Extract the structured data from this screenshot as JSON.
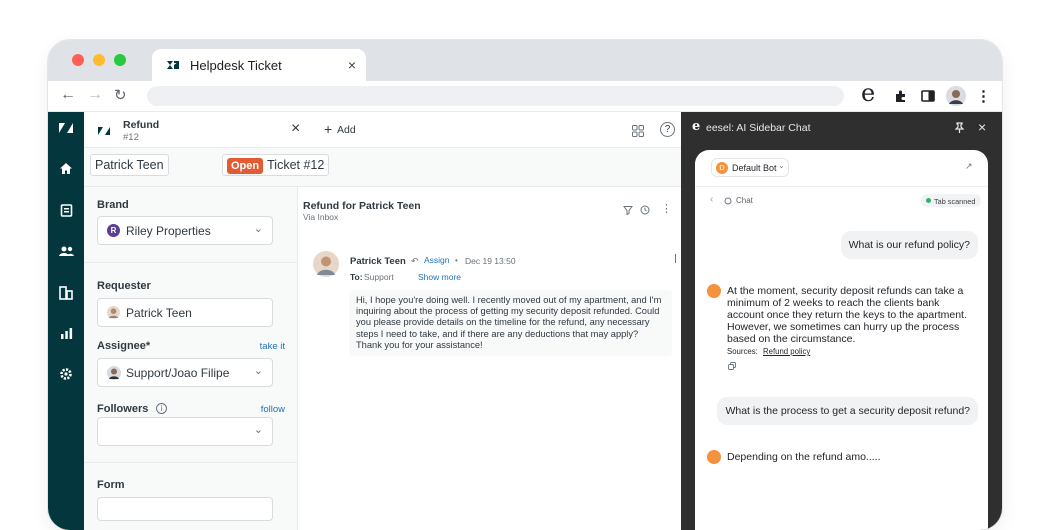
{
  "browser": {
    "traffic_lights": [
      "#fe5f57",
      "#febc2e",
      "#28c840"
    ],
    "tab": {
      "title": "Helpdesk Ticket",
      "close": "×"
    },
    "nav": {
      "back": "←",
      "forward": "→",
      "reload": "↻"
    },
    "extensions": {
      "e_label": "e",
      "menu": "⋮"
    }
  },
  "rail": {
    "items": [
      "logo",
      "home",
      "views",
      "customers",
      "organizations",
      "reporting",
      "admin"
    ]
  },
  "header": {
    "ticket_tab": {
      "title": "Refund",
      "subtitle": "#12",
      "close": "×"
    },
    "add_label": "Add",
    "add_plus": "+",
    "help": "?"
  },
  "subheader": {
    "requester_chip": "Patrick Teen",
    "status_badge": "Open",
    "ticket_label": "Ticket #12"
  },
  "form": {
    "brand": {
      "label": "Brand",
      "value": "Riley Properties",
      "initial": "R"
    },
    "requester": {
      "label": "Requester",
      "value": "Patrick Teen"
    },
    "assignee": {
      "label": "Assignee*",
      "link": "take it",
      "value": "Support/Joao Filipe"
    },
    "followers": {
      "label": "Followers",
      "info": "i",
      "link": "follow",
      "value": ""
    },
    "form_label": "Form"
  },
  "thread": {
    "title": "Refund for Patrick Teen",
    "channel": "Via Inbox",
    "message": {
      "author": "Patrick Teen",
      "assign_label": "Assign",
      "time": "Dec 19 13:50",
      "to_label": "To:",
      "to_value": "Support",
      "show_more": "Show more",
      "body": "Hi, I hope you're doing well. I recently moved out of my apartment, and I'm inquiring about the process of getting my security deposit refunded. Could you please provide details on the timeline for the refund, any necessary steps I need to take, and if there are any deductions that may apply? Thank you for your assistance!"
    }
  },
  "sidebar": {
    "logo": "e",
    "title": "eesel: AI Sidebar Chat",
    "close": "×",
    "bot_initial": "D",
    "bot_name": "Default Bot",
    "expand": "↗",
    "back": "‹",
    "chat_label": "Chat",
    "tab_status": "Tab scanned",
    "messages": [
      {
        "role": "user",
        "text": "What is our refund policy?"
      },
      {
        "role": "bot",
        "text": "At the moment, security deposit refunds can take a minimum of 2 weeks to reach the clients bank account once they return the keys to the apartment. However, we sometimes can hurry up the process based on the circumstance.",
        "sources_label": "Sources:",
        "source_link": "Refund policy"
      },
      {
        "role": "user",
        "text": "What is the process to get a security deposit refund?"
      },
      {
        "role": "bot",
        "text": "Depending on the refund amo....."
      }
    ]
  },
  "colors": {
    "rail": "#03363d",
    "open_badge": "#e35b33",
    "link": "#1f73b7",
    "sidebar_bg": "#2f2f2f",
    "bot_avatar": "#f5923e",
    "scanned_dot": "#2fb36b"
  }
}
